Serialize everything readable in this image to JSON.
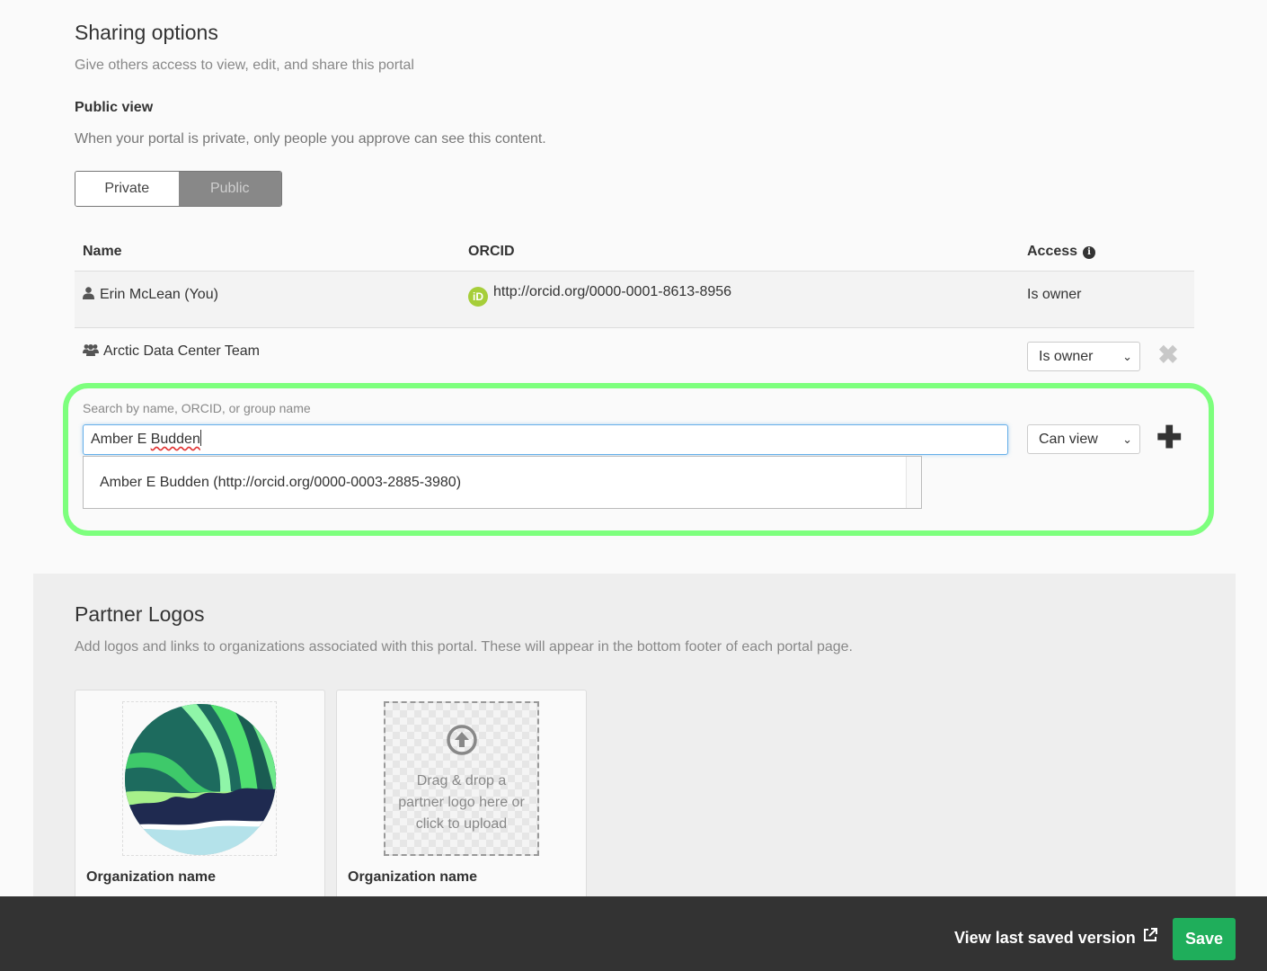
{
  "sharing": {
    "title": "Sharing options",
    "subtitle": "Give others access to view, edit, and share this portal",
    "public_view": {
      "heading": "Public view",
      "description": "When your portal is private, only people you approve can see this content.",
      "options": [
        "Private",
        "Public"
      ],
      "selected": "Public"
    },
    "table": {
      "headers": {
        "name": "Name",
        "orcid": "ORCID",
        "access": "Access"
      },
      "rows": [
        {
          "name": "Erin McLean (You)",
          "orcid": "http://orcid.org/0000-0001-8613-8956",
          "access": "Is owner",
          "icon": "user-icon"
        },
        {
          "name": "Arctic Data Center Team",
          "orcid": "",
          "access": "Is owner",
          "icon": "group-icon"
        }
      ]
    },
    "search": {
      "label": "Search by name, ORCID, or group name",
      "value_prefix": "Amber E ",
      "value_misspelled": "Budden",
      "access": "Can view",
      "suggestion": "Amber E Budden (http://orcid.org/0000-0003-2885-3980)"
    }
  },
  "partners": {
    "title": "Partner Logos",
    "subtitle": "Add logos and links to organizations associated with this portal. These will appear in the bottom footer of each portal page.",
    "cards": [
      {
        "org_label": "Organization name"
      },
      {
        "org_label": "Organization name",
        "upload_text_1": "Drag & drop a",
        "upload_text_2": "partner logo here or",
        "upload_text_3": "click to upload"
      }
    ]
  },
  "footer": {
    "view_last": "View last saved version",
    "save": "Save"
  },
  "colors": {
    "highlight": "#7dff7d",
    "save_button": "#1fae5b",
    "orcid": "#a6ce39",
    "footer_bg": "#333333"
  }
}
